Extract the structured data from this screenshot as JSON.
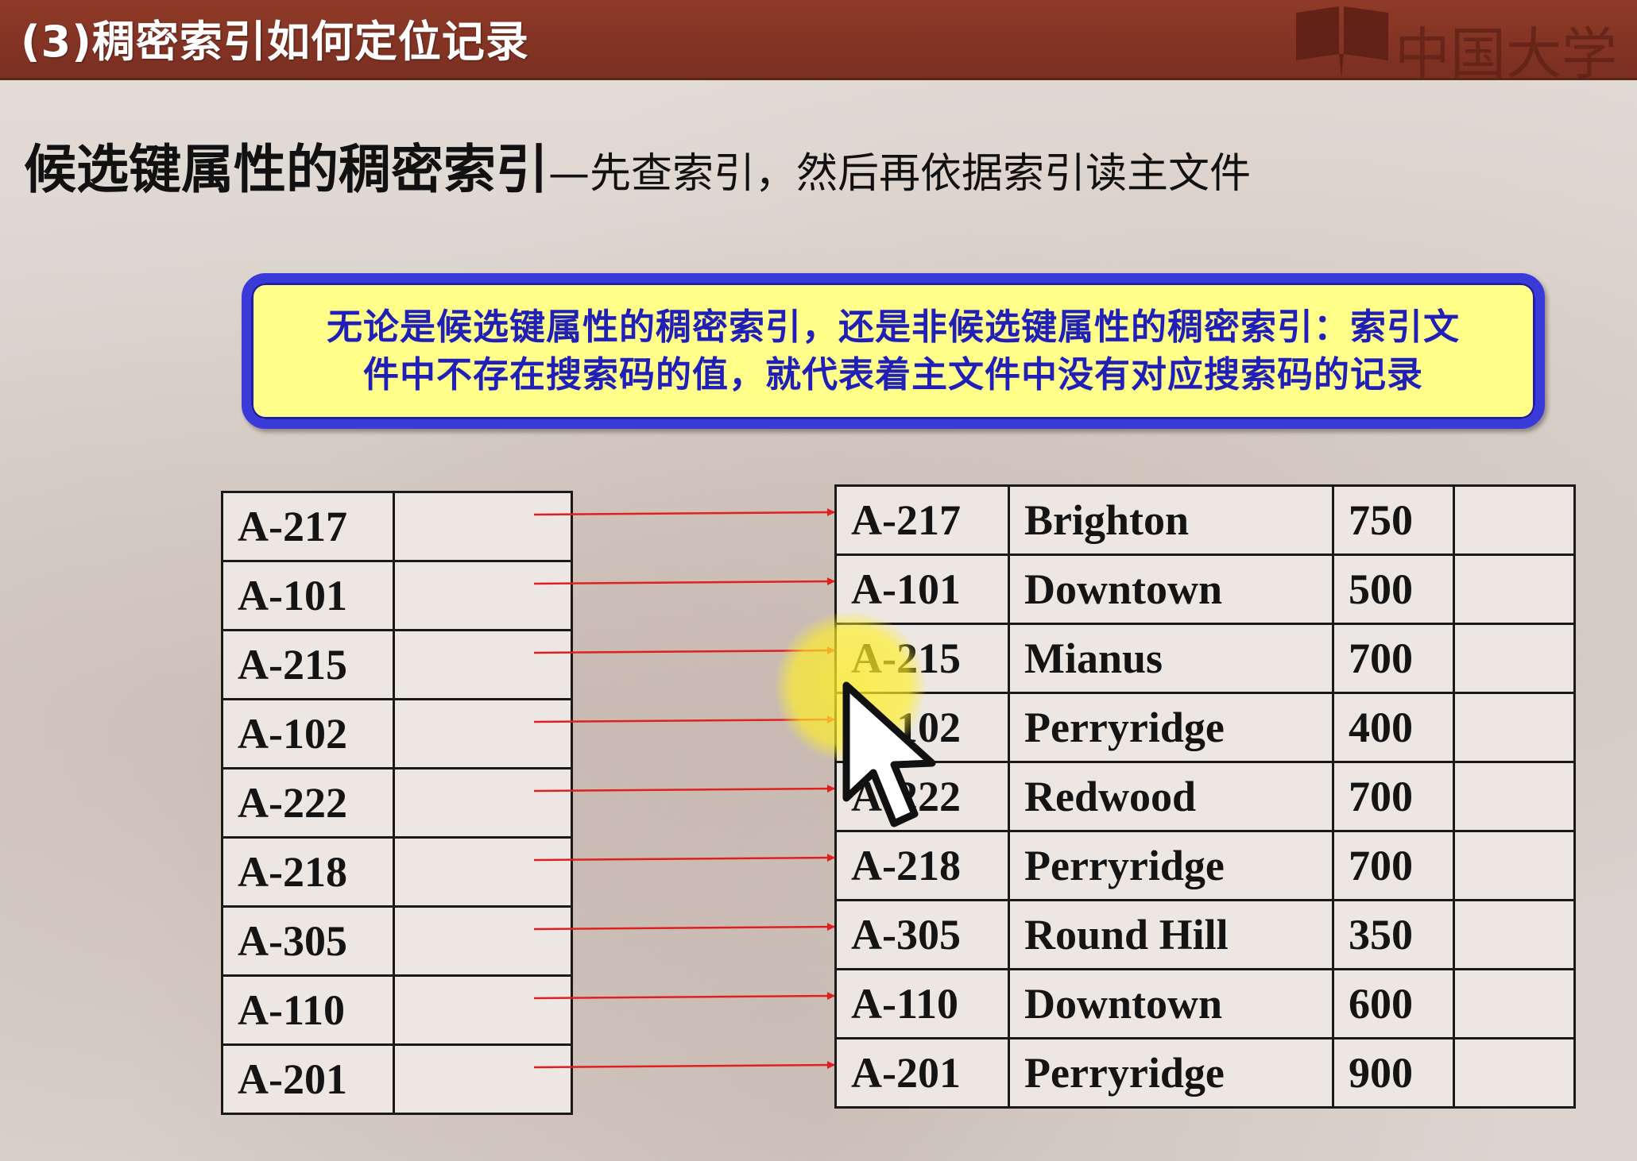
{
  "slide": {
    "title": "(3)稠密索引如何定位记录",
    "logo_text": "中国大学",
    "heading_main": "候选键属性的稠密索引",
    "heading_sub": "—先查索引，然后再依据索引读主文件",
    "callout_line1": "无论是候选键属性的稠密索引，还是非候选键属性的稠密索引：索引文",
    "callout_line2": "件中不存在搜索码的值，就代表着主文件中没有对应搜索码的记录"
  },
  "index_table": {
    "keys": [
      "A-217",
      "A-101",
      "A-215",
      "A-102",
      "A-222",
      "A-218",
      "A-305",
      "A-110",
      "A-201"
    ]
  },
  "main_table": {
    "rows": [
      [
        "A-217",
        "Brighton",
        "750"
      ],
      [
        "A-101",
        "Downtown",
        "500"
      ],
      [
        "A-215",
        "Mianus",
        "700"
      ],
      [
        "A-102",
        "Perryridge",
        "400"
      ],
      [
        "A-222",
        "Redwood",
        "700"
      ],
      [
        "A-218",
        "Perryridge",
        "700"
      ],
      [
        "A-305",
        "Round Hill",
        "350"
      ],
      [
        "A-110",
        "Downtown",
        "600"
      ],
      [
        "A-201",
        "Perryridge",
        "900"
      ]
    ]
  },
  "colors": {
    "title_bar": "#8f3a28",
    "callout_fill": "#ffff8a",
    "callout_border": "#3a3ad8",
    "callout_text": "#2020b8",
    "arrow": "#e02020",
    "highlight": "#ffee28"
  },
  "icons": {
    "logo": "book-icon",
    "cursor": "mouse-pointer-icon"
  }
}
